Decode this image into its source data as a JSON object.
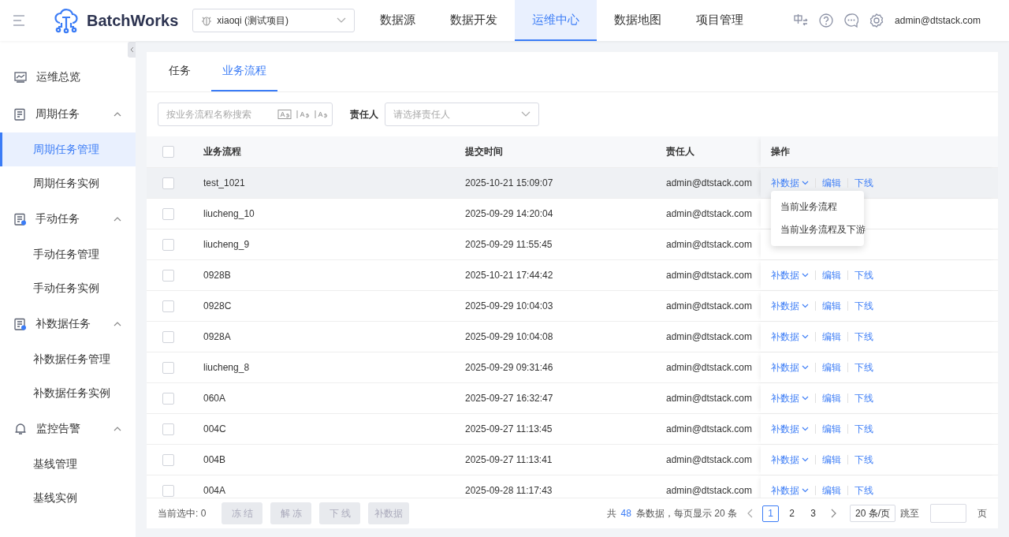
{
  "header": {
    "app_name": "BatchWorks",
    "project": "xiaoqi (测试项目)",
    "nav": [
      {
        "label": "数据源",
        "selected": false
      },
      {
        "label": "数据开发",
        "selected": false
      },
      {
        "label": "运维中心",
        "selected": true
      },
      {
        "label": "数据地图",
        "selected": false
      },
      {
        "label": "项目管理",
        "selected": false
      }
    ],
    "user": "admin@dtstack.com"
  },
  "sidebar": {
    "items": [
      {
        "kind": "link",
        "label": "运维总览"
      },
      {
        "kind": "group",
        "label": "周期任务",
        "expanded": true,
        "children": [
          {
            "label": "周期任务管理",
            "selected": true
          },
          {
            "label": "周期任务实例",
            "selected": false
          }
        ]
      },
      {
        "kind": "group",
        "label": "手动任务",
        "expanded": true,
        "children": [
          {
            "label": "手动任务管理",
            "selected": false
          },
          {
            "label": "手动任务实例",
            "selected": false
          }
        ]
      },
      {
        "kind": "group",
        "label": "补数据任务",
        "expanded": true,
        "children": [
          {
            "label": "补数据任务管理",
            "selected": false
          },
          {
            "label": "补数据任务实例",
            "selected": false
          }
        ]
      },
      {
        "kind": "group",
        "label": "监控告警",
        "expanded": true,
        "children": [
          {
            "label": "基线管理",
            "selected": false
          },
          {
            "label": "基线实例",
            "selected": false
          }
        ]
      }
    ]
  },
  "tabs": [
    {
      "label": "任务",
      "selected": false
    },
    {
      "label": "业务流程",
      "selected": true
    }
  ],
  "filters": {
    "search": {
      "placeholder": "按业务流程名称搜索"
    },
    "owner_label": "责任人",
    "owner": {
      "placeholder": "请选择责任人"
    }
  },
  "table": {
    "all_checked": false,
    "columns": [
      "业务流程",
      "提交时间",
      "责任人",
      "操作"
    ],
    "rows": [
      {
        "checked": false,
        "hovered": true,
        "name": "test_1021",
        "time": "2025-10-21 15:09:07",
        "owner": "admin@dtstack.com",
        "actions": [
          "补数据",
          "编辑",
          "下线"
        ],
        "menu": [
          "当前业务流程",
          "当前业务流程及下游"
        ]
      },
      {
        "checked": false,
        "hovered": false,
        "name": "liucheng_10",
        "time": "2025-09-29 14:20:04",
        "owner": "admin@dtstack.com"
      },
      {
        "checked": false,
        "hovered": false,
        "name": "liucheng_9",
        "time": "2025-09-29 11:55:45",
        "owner": "admin@dtstack.com"
      },
      {
        "checked": false,
        "hovered": false,
        "name": "0928B",
        "time": "2025-10-21 17:44:42",
        "owner": "admin@dtstack.com",
        "actions": [
          "补数据",
          "编辑",
          "下线"
        ]
      },
      {
        "checked": false,
        "hovered": false,
        "name": "0928C",
        "time": "2025-09-29 10:04:03",
        "owner": "admin@dtstack.com",
        "actions": [
          "补数据",
          "编辑",
          "下线"
        ]
      },
      {
        "checked": false,
        "hovered": false,
        "name": "0928A",
        "time": "2025-09-29 10:04:08",
        "owner": "admin@dtstack.com",
        "actions": [
          "补数据",
          "编辑",
          "下线"
        ]
      },
      {
        "checked": false,
        "hovered": false,
        "name": "liucheng_8",
        "time": "2025-09-29 09:31:46",
        "owner": "admin@dtstack.com",
        "actions": [
          "补数据",
          "编辑",
          "下线"
        ]
      },
      {
        "checked": false,
        "hovered": false,
        "name": "060A",
        "time": "2025-09-27 16:32:47",
        "owner": "admin@dtstack.com",
        "actions": [
          "补数据",
          "编辑",
          "下线"
        ]
      },
      {
        "checked": false,
        "hovered": false,
        "name": "004C",
        "time": "2025-09-27 11:13:45",
        "owner": "admin@dtstack.com",
        "actions": [
          "补数据",
          "编辑",
          "下线"
        ]
      },
      {
        "checked": false,
        "hovered": false,
        "name": "004B",
        "time": "2025-09-27 11:13:41",
        "owner": "admin@dtstack.com",
        "actions": [
          "补数据",
          "编辑",
          "下线"
        ]
      },
      {
        "checked": false,
        "hovered": false,
        "name": "004A",
        "time": "2025-09-28 11:17:43",
        "owner": "admin@dtstack.com",
        "actions": [
          "补数据",
          "编辑",
          "下线"
        ]
      }
    ]
  },
  "footer": {
    "selected_count": "当前选中: 0",
    "buttons": [
      {
        "label": "冻 结",
        "disabled": true
      },
      {
        "label": "解 冻",
        "disabled": true
      },
      {
        "label": "下 线",
        "disabled": true
      },
      {
        "label": "补数据",
        "disabled": true
      }
    ],
    "total_prefix": "共",
    "total": "48",
    "total_suffix": "条数据，每页显示 20 条",
    "pages": [
      {
        "label": "1",
        "selected": true
      },
      {
        "label": "2",
        "selected": false
      },
      {
        "label": "3",
        "selected": false
      }
    ],
    "page_size": "20 条/页",
    "jump_label": "跳至",
    "page_unit": "页"
  }
}
